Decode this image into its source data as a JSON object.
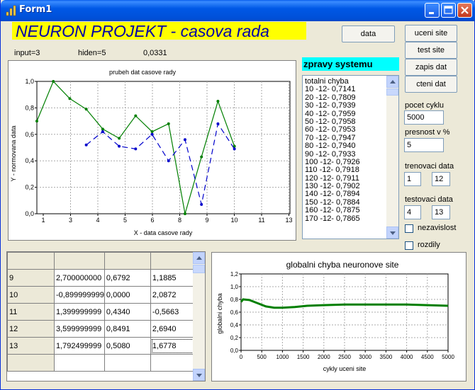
{
  "window": {
    "title": "Form1"
  },
  "banner": {
    "text": "NEURON PROJEKT - casova rada"
  },
  "status": {
    "input": "input=3",
    "hiden": "hiden=5",
    "error": "0,0331"
  },
  "buttons": {
    "data": "data",
    "uceni": "uceni site",
    "test": "test site",
    "zapis": "zapis dat",
    "cteni": "cteni dat"
  },
  "messages": {
    "header": "zpravy systemu",
    "items": [
      "totalni chyba",
      "10 -12- 0,7141",
      "20 -12- 0,7809",
      "30 -12- 0,7939",
      "40 -12- 0,7959",
      "50 -12- 0,7958",
      "60 -12- 0,7953",
      "70 -12- 0,7947",
      "80 -12- 0,7940",
      "90 -12- 0,7933",
      "100 -12- 0,7926",
      "110 -12- 0,7918",
      "120 -12- 0,7911",
      "130 -12- 0,7902",
      "140 -12- 0,7894",
      "150 -12- 0,7884",
      "160 -12- 0,7875",
      "170 -12- 0,7865"
    ]
  },
  "params": {
    "cycles_label": "pocet cyklu",
    "cycles": "5000",
    "precision_label": "presnost v %",
    "precision": "5",
    "train_label": "trenovaci data",
    "train_from": "1",
    "train_to": "12",
    "test_label": "testovaci data",
    "test_from": "4",
    "test_to": "13",
    "independence_label": "nezavislost",
    "differences_label": "rozdily"
  },
  "grid": {
    "rows": [
      [
        "9",
        "2,700000000",
        "0,6792",
        "1,1885"
      ],
      [
        "10",
        "-0,899999999",
        "0,0000",
        "2,0872"
      ],
      [
        "11",
        "1,399999999",
        "0,4340",
        "-0,5663"
      ],
      [
        "12",
        "3,599999999",
        "0,8491",
        "2,6940"
      ],
      [
        "13",
        "1,792499999",
        "0,5080",
        "1,6778"
      ]
    ]
  },
  "chart_data": [
    {
      "type": "line",
      "title": "prubeh dat casove rady",
      "xlabel": "X - data casove rady",
      "ylabel": "Y - normovana data",
      "x_ticks": [
        "1",
        "3",
        "4",
        "5",
        "6",
        "8",
        "9",
        "10",
        "11",
        "13"
      ],
      "y_ticks": [
        "0,0",
        "0,2",
        "0,4",
        "0,6",
        "0,8",
        "1,0"
      ],
      "xlim": [
        0.8,
        13.1
      ],
      "ylim": [
        0,
        1
      ],
      "grid": true,
      "series": [
        {
          "color": "#007F00",
          "style": "solid",
          "points": [
            [
              0.8,
              0.7
            ],
            [
              1.6,
              1.0
            ],
            [
              2.4,
              0.87
            ],
            [
              3.2,
              0.79
            ],
            [
              4.0,
              0.64
            ],
            [
              4.8,
              0.57
            ],
            [
              5.6,
              0.74
            ],
            [
              6.4,
              0.62
            ],
            [
              7.2,
              0.68
            ],
            [
              8.0,
              0.0
            ],
            [
              8.8,
              0.43
            ],
            [
              9.6,
              0.85
            ],
            [
              10.4,
              0.51
            ]
          ]
        },
        {
          "color": "#0000CC",
          "style": "dashed",
          "points": [
            [
              3.2,
              0.52
            ],
            [
              4.0,
              0.62
            ],
            [
              4.8,
              0.51
            ],
            [
              5.6,
              0.49
            ],
            [
              6.4,
              0.6
            ],
            [
              7.2,
              0.4
            ],
            [
              8.0,
              0.56
            ],
            [
              8.8,
              0.07
            ],
            [
              9.6,
              0.68
            ],
            [
              10.4,
              0.49
            ]
          ]
        }
      ]
    },
    {
      "type": "line",
      "title": "globalni chyba neuronove site",
      "xlabel": "cykly uceni site",
      "ylabel": "globalni chyba",
      "x_ticks": [
        "0",
        "500",
        "1000",
        "1500",
        "2000",
        "2500",
        "3000",
        "3500",
        "4000",
        "4500",
        "5000"
      ],
      "y_ticks": [
        "0,0",
        "0,2",
        "0,4",
        "0,6",
        "0,8",
        "1,0",
        "1,2"
      ],
      "xlim": [
        0,
        5000
      ],
      "ylim": [
        0,
        1.2
      ],
      "grid": true,
      "series": [
        {
          "color": "#007F00",
          "style": "solid",
          "points": [
            [
              0,
              0.76
            ],
            [
              50,
              0.8
            ],
            [
              200,
              0.79
            ],
            [
              400,
              0.74
            ],
            [
              600,
              0.69
            ],
            [
              800,
              0.67
            ],
            [
              1000,
              0.67
            ],
            [
              1300,
              0.68
            ],
            [
              1600,
              0.7
            ],
            [
              2000,
              0.71
            ],
            [
              2500,
              0.72
            ],
            [
              3000,
              0.72
            ],
            [
              3500,
              0.72
            ],
            [
              4000,
              0.72
            ],
            [
              4500,
              0.71
            ],
            [
              5000,
              0.7
            ]
          ]
        }
      ]
    }
  ]
}
